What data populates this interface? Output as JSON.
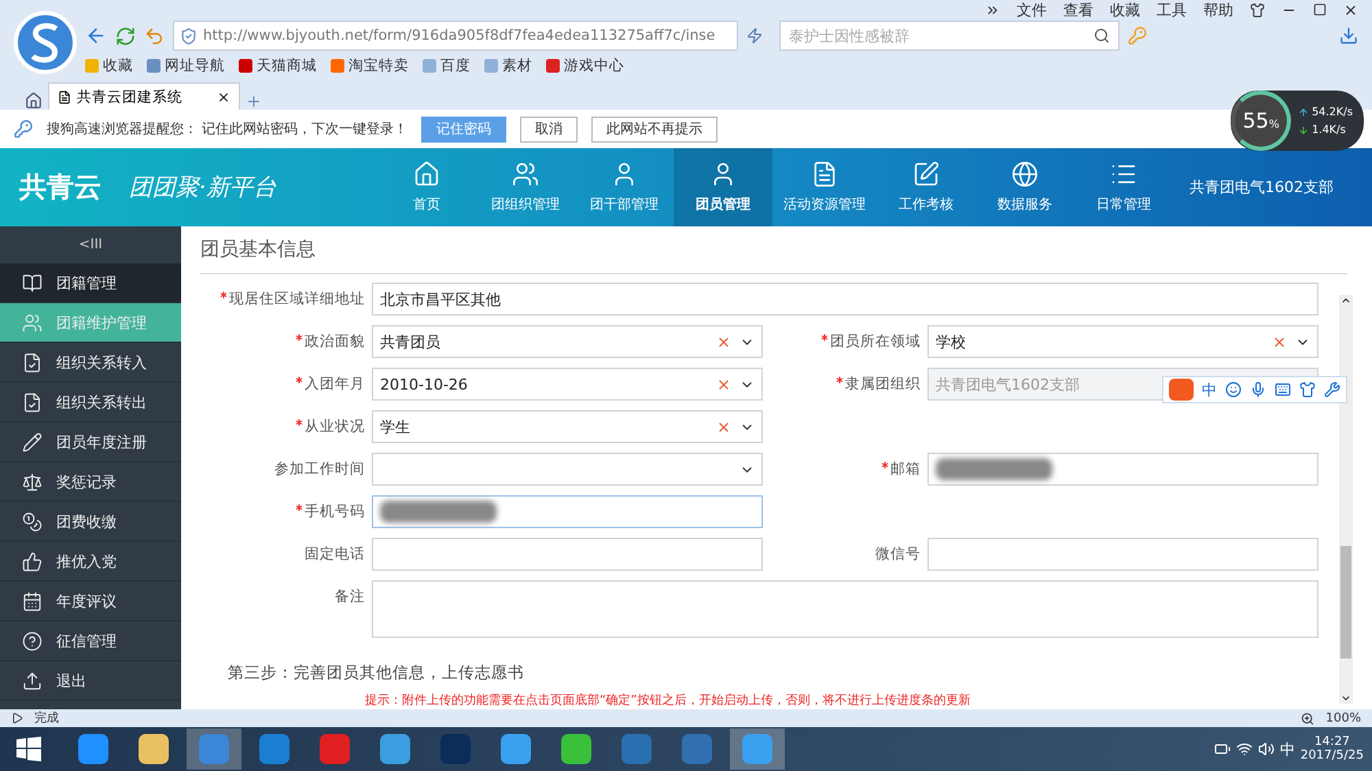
{
  "browser": {
    "menu": [
      "文件",
      "查看",
      "收藏",
      "工具",
      "帮助"
    ],
    "url": "http://www.bjyouth.net/form/916da905f8df7fea4edea113275aff7c/inse",
    "search_placeholder": "泰护士因性感被辞",
    "bookmarks": [
      {
        "label": "收藏",
        "kind": "star"
      },
      {
        "label": "网址导航",
        "kind": "globe"
      },
      {
        "label": "天猫商城",
        "kind": "tmall"
      },
      {
        "label": "淘宝特卖",
        "kind": "taobao"
      },
      {
        "label": "百度",
        "kind": "folder"
      },
      {
        "label": "素材",
        "kind": "folder"
      },
      {
        "label": "游戏中心",
        "kind": "game"
      }
    ],
    "tab": {
      "title": "共青云团建系统",
      "selected": true
    },
    "notice": {
      "text": "搜狗高速浏览器提醒您： 记住此网站密码，下次一键登录！",
      "buttons": [
        {
          "label": "记住密码",
          "primary": true
        },
        {
          "label": "取消",
          "primary": false
        },
        {
          "label": "此网站不再提示",
          "primary": false
        }
      ]
    },
    "speed": {
      "percent": "55",
      "unit": "%",
      "up": "54.2K/s",
      "down": "1.4K/s"
    }
  },
  "header": {
    "logo": "共青云",
    "slogan": "团团聚·新平台",
    "nav": [
      {
        "label": "首页",
        "selected": false
      },
      {
        "label": "团组织管理",
        "selected": false
      },
      {
        "label": "团干部管理",
        "selected": false
      },
      {
        "label": "团员管理",
        "selected": true
      },
      {
        "label": "活动资源管理",
        "selected": false
      },
      {
        "label": "工作考核",
        "selected": false
      },
      {
        "label": "数据服务",
        "selected": false
      },
      {
        "label": "日常管理",
        "selected": false
      }
    ],
    "org": "共青团电气1602支部"
  },
  "sidebar": {
    "collapse": "<III",
    "items": [
      {
        "label": "团籍管理",
        "kind": "group",
        "selected": false
      },
      {
        "label": "团籍维护管理",
        "kind": "item",
        "selected": true
      },
      {
        "label": "组织关系转入",
        "kind": "item",
        "selected": false
      },
      {
        "label": "组织关系转出",
        "kind": "item",
        "selected": false
      },
      {
        "label": "团员年度注册",
        "kind": "item",
        "selected": false
      },
      {
        "label": "奖惩记录",
        "kind": "item",
        "selected": false
      },
      {
        "label": "团费收缴",
        "kind": "item",
        "selected": false
      },
      {
        "label": "推优入党",
        "kind": "item",
        "selected": false
      },
      {
        "label": "年度评议",
        "kind": "item",
        "selected": false
      },
      {
        "label": "征信管理",
        "kind": "item",
        "selected": false
      },
      {
        "label": "退出",
        "kind": "item",
        "selected": false
      }
    ]
  },
  "form": {
    "title": "团员基本信息",
    "rows": [
      [
        {
          "label": "现居住区域详细地址",
          "required": true,
          "kind": "text",
          "value": "北京市昌平区其他",
          "wide": true
        }
      ],
      [
        {
          "label": "政治面貌",
          "required": true,
          "kind": "select",
          "value": "共青团员",
          "clearable": true
        },
        {
          "label": "团员所在领域",
          "required": true,
          "kind": "select",
          "value": "学校",
          "clearable": true
        }
      ],
      [
        {
          "label": "入团年月",
          "required": true,
          "kind": "select",
          "value": "2010-10-26",
          "clearable": true
        },
        {
          "label": "隶属团组织",
          "required": true,
          "kind": "text",
          "value": "共青团电气1602支部",
          "disabled": true
        }
      ],
      [
        {
          "label": "从业状况",
          "required": true,
          "kind": "select",
          "value": "学生",
          "clearable": true
        }
      ],
      [
        {
          "label": "参加工作时间",
          "required": false,
          "kind": "select",
          "clearable": false
        },
        {
          "label": "邮箱",
          "required": true,
          "kind": "redacted"
        }
      ],
      [
        {
          "label": "手机号码",
          "required": true,
          "kind": "redacted",
          "focused": true
        }
      ],
      [
        {
          "label": "固定电话",
          "required": false,
          "kind": "text"
        },
        {
          "label": "微信号",
          "required": false,
          "kind": "text"
        }
      ],
      [
        {
          "label": "备注",
          "required": false,
          "kind": "textarea",
          "wide": true
        }
      ]
    ],
    "step": "第三步：完善团员其他信息，上传志愿书",
    "hint": "提示：附件上传的功能需要在点击页面底部“确定”按钮之后，开始启动上传，否则，将不进行上传进度条的更新"
  },
  "ime": {
    "mode": "中"
  },
  "status_bar": {
    "text": "完成",
    "zoom": "100%"
  },
  "taskbar": {
    "apps": [
      {
        "kind": "ie",
        "active": false
      },
      {
        "kind": "folder",
        "active": false
      },
      {
        "kind": "sogou",
        "active": true
      },
      {
        "kind": "k",
        "active": false
      },
      {
        "kind": "mail",
        "active": false
      },
      {
        "kind": "cloud",
        "active": false
      },
      {
        "kind": "ps",
        "active": false
      },
      {
        "kind": "w",
        "active": false
      },
      {
        "kind": "iqiyi",
        "active": false
      },
      {
        "kind": "film",
        "active": false
      },
      {
        "kind": "globe",
        "active": false
      },
      {
        "kind": "w",
        "active": true
      }
    ],
    "ime": "中",
    "time": "14:27",
    "date": "2017/5/25"
  }
}
